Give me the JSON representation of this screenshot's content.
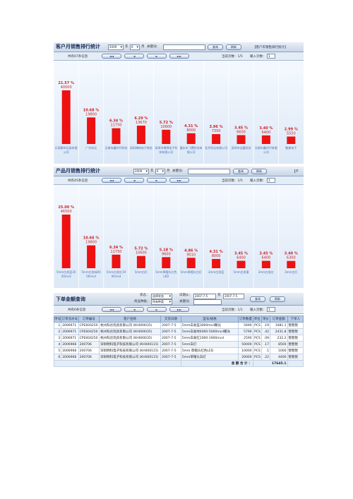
{
  "panel1": {
    "title": "客户月销售排行统计",
    "year": "2009",
    "year_suffix": "年",
    "month": "6",
    "month_suffix": "月",
    "keyword_label": "关键词：",
    "keyword_value": "",
    "query_btn": "查询",
    "refresh_btn": "刷新",
    "right_link": "【客户年销售排行统计】",
    "record_count": "共有67条信息",
    "page_info": "当前页数：1/5",
    "page_input_label": "输入页数：",
    "page_input_value": "1"
  },
  "panel2": {
    "title": "产品月销售排行统计",
    "year": "2009",
    "year_suffix": "年",
    "month": "6",
    "month_suffix": "月",
    "keyword_label": "关键词：",
    "keyword_value": "",
    "query_btn": "查询",
    "refresh_btn": "刷新",
    "right_link": "【产",
    "record_count": "共有45条信息",
    "page_info": "当前页数：1/5",
    "page_input_label": "输入页数：",
    "page_input_value": "1"
  },
  "panel3": {
    "title": "下单金额查询",
    "status_label": "状态：",
    "status_value": "选择状态",
    "category_label": "商品种类：",
    "category_value": "所有种类",
    "date_label": "日期从：",
    "date_from": "2007-7-5",
    "date_to_label": "到",
    "date_to": "2007-7-5",
    "keyword_label": "关键词：",
    "keyword_value": "",
    "query_btn": "查询",
    "refresh_btn": "刷新",
    "record_count": "共有6条信息",
    "page_info": "当前页数：1/1",
    "page_input_label": "输入页数：",
    "page_input_value": "1",
    "headers": [
      "序号",
      "订单流水号",
      "订单编号",
      "客户名称",
      "交货日期",
      "型号/规格",
      "订单数量",
      "单位",
      "单价",
      "订单金额",
      "下单人"
    ],
    "rows": [
      [
        "1",
        "2006971",
        "CPE604250",
        "杭州科达玩具有限公司 (KH000035)",
        "2007-7-5",
        "5mm白发蓝3000mcd聚光",
        "5690",
        "PCS",
        ".19",
        "1081.1",
        "暂暂暂"
      ],
      [
        "2",
        "2006971",
        "CPE604250",
        "杭州科达玩具有限公司 (KH000035)",
        "2007-7-5",
        "5mm白发绿4000-5000mcd聚光",
        "5790",
        "PCS",
        ".42",
        "2431.8",
        "暂暂暂"
      ],
      [
        "3",
        "2006971",
        "CPE604250",
        "杭州科达玩具有限公司 (KH000035)",
        "2007-7-5",
        "5mm白发红1000-1900mcd",
        "2590",
        "PCS",
        ".09",
        "232.2",
        "暂暂暂"
      ],
      [
        "4",
        "2006968",
        "200706",
        "深圳明科电子科技有限公司 (KH000115)",
        "2007-7-5",
        "5mm白灯",
        "50000",
        "PCS",
        ".17",
        "8500",
        "暂暂暂"
      ],
      [
        "5",
        "2006968",
        "200706",
        "深圳明科电子科技有限公司 (KH000115)",
        "2007-7-5",
        "5mm 草帽头红色LED",
        "10000",
        "PCS",
        ".1",
        "1000",
        "暂暂暂"
      ],
      [
        "6",
        "2006968",
        "200706",
        "深圳明科电子科技有限公司 (KH000115)",
        "2007-7-5",
        "5mm草帽头白灯",
        "20000",
        "PCS",
        ".22",
        "4400",
        "暂暂暂"
      ]
    ],
    "total_label": "金 额 合 计 ：",
    "total_value": "17645.1"
  },
  "pager": {
    "first": "◄◄",
    "prev": "◄",
    "next": "►",
    "last": "►►"
  },
  "colors": {
    "bar": "#ee1111",
    "label": "#cc2222",
    "cat": "#4a70b0"
  },
  "chart_data": [
    {
      "type": "bar",
      "categories": [
        "乐高都市玩具有限公司",
        "广东科达",
        "无锡市鑫时代科技",
        "深圳博纳电子商务",
        "深圳市博得电子科技有限公司",
        "重庆市飞鹰科技有限公司",
        "北京科达有限公司",
        "深圳市宝嘉科技",
        "无锡市鑫时代有限公司",
        "聚美电子"
      ],
      "values": [
        40000,
        19800,
        11750,
        13670,
        10600,
        8000,
        7350,
        6600,
        6400,
        5550
      ],
      "percent_labels": [
        "21.57 %",
        "10.68 %",
        "6.34 %",
        "6.29 %",
        "5.72 %",
        "4.31 %",
        "3.96 %",
        "3.45 %",
        "3.40 %",
        "2.99 %"
      ]
    },
    {
      "type": "bar",
      "categories": [
        "5mm白发蓝3000mcd",
        "5mm白发绿4000mcd",
        "5mm白发红1900mcd",
        "5mm白灯",
        "5mm草帽头红色LED",
        "5mm草帽头白灯",
        "3mm白发蓝",
        "5mm白发黄",
        "3mm白发红",
        "3mm白灯"
      ],
      "values": [
        46500,
        19800,
        11750,
        10600,
        9600,
        9010,
        8000,
        6400,
        6400,
        6300
      ],
      "percent_labels": [
        "25.00 %",
        "10.66 %",
        "6.34 %",
        "5.72 %",
        "5.18 %",
        "4.86 %",
        "4.31 %",
        "3.45 %",
        "3.45 %",
        "3.40 %"
      ]
    }
  ]
}
